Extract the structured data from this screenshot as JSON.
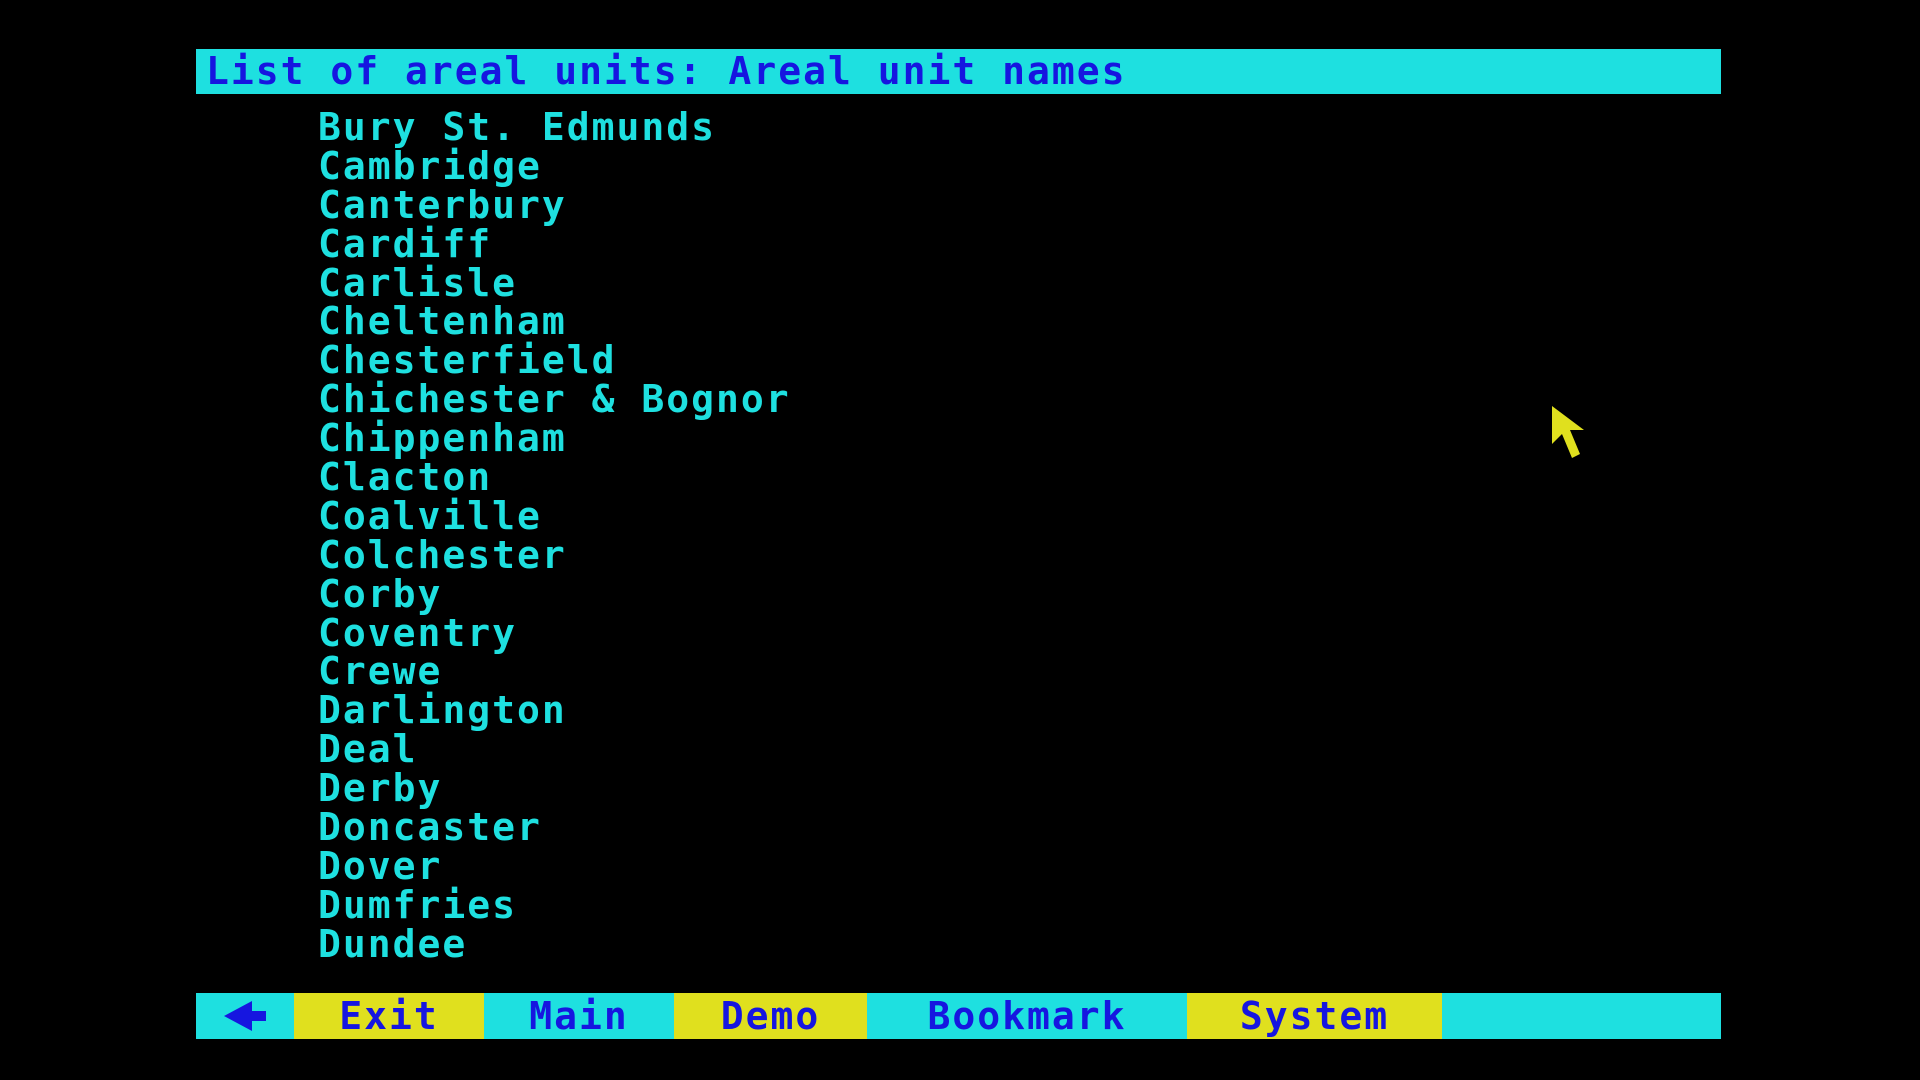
{
  "title": "List of areal units: Areal unit names",
  "units": [
    "Bury St. Edmunds",
    "Cambridge",
    "Canterbury",
    "Cardiff",
    "Carlisle",
    "Cheltenham",
    "Chesterfield",
    "Chichester & Bognor",
    "Chippenham",
    "Clacton",
    "Coalville",
    "Colchester",
    "Corby",
    "Coventry",
    "Crewe",
    "Darlington",
    "Deal",
    "Derby",
    "Doncaster",
    "Dover",
    "Dumfries",
    "Dundee"
  ],
  "menu": {
    "back_icon": "left-arrow-icon",
    "exit": "Exit",
    "main": "Main",
    "demo": "Demo",
    "bookmark": "Bookmark",
    "system": "System"
  },
  "colors": {
    "background": "#000000",
    "cyan": "#1ee0e0",
    "yellow": "#e0e01e",
    "blue": "#1616e0"
  },
  "pointer_icon": "arrow-pointer-icon"
}
